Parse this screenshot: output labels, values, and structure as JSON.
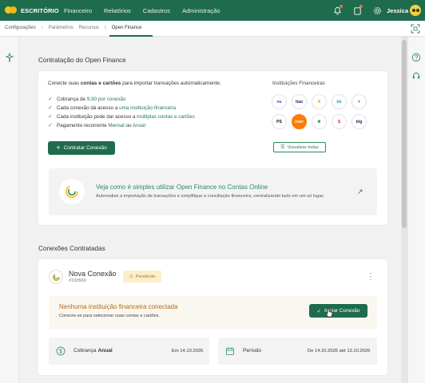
{
  "topbar": {
    "brand": "ESCRITÓRIO",
    "nav": [
      "Financeiro",
      "Relatórios",
      "Cadastros",
      "Administração"
    ],
    "icons": [
      "bell-settings-icon",
      "notification-icon",
      "gear-icon"
    ],
    "user": "Jessica"
  },
  "breadcrumb": {
    "items": [
      "Configurações",
      "Parâmetros",
      "Recursos",
      "Open Finance"
    ]
  },
  "contratacao": {
    "section_title": "Contratação do Open Finance",
    "intro_pre": "Conecte suas ",
    "intro_bold": "contas e cartões",
    "intro_post": " para importar transações automaticamente.",
    "features": [
      {
        "pre": "Cobrança de ",
        "hl": "9,90 por conexão",
        "post": ""
      },
      {
        "pre": "Cada conexão dá acesso a ",
        "hl": "uma instituição financeira",
        "post": ""
      },
      {
        "pre": "Cada instituição pode dar acesso a ",
        "hl": "múltiplas contas e cartões",
        "post": ""
      },
      {
        "pre": "Pagamento recorrente ",
        "hl": "Mensal",
        "mid": " ou ",
        "hl2": "Anual"
      }
    ],
    "contract_button": "Contratar Conexão",
    "institutions_title": "Instituições Financeiras",
    "institutions": [
      {
        "label": "nu",
        "color": "#7b2cbf"
      },
      {
        "label": "itaú",
        "color": "#1b2b6b"
      },
      {
        "label": "X",
        "color": "#f28c00"
      },
      {
        "label": "bb",
        "color": "#2aa3c3"
      },
      {
        "label": "▼",
        "color": "#56a832"
      },
      {
        "label": "PS",
        "color": "#111111"
      },
      {
        "label": "inter",
        "color": "#ff7a00"
      },
      {
        "label": "✱",
        "color": "#2c9e3c"
      },
      {
        "label": "S",
        "color": "#c8202f"
      },
      {
        "label": "btg",
        "color": "#0d2e5c"
      }
    ],
    "view_all_button": "Visualizar todas",
    "promo_title": "Veja como é simples utilizar Open Finance no Contas Online",
    "promo_subtitle": "Automatize a importação de transações e simplifique a conciliação financeira, centralizando tudo em um só lugar."
  },
  "conexoes": {
    "section_title": "Conexões Contratadas",
    "connection_name": "Nova Conexão",
    "connection_id": "#100569",
    "status": "Pendente",
    "no_institution_title": "Nenhuma instituição financeira conectada",
    "no_institution_sub": "Conecte-se para selecionar suas contas e cartões.",
    "start_button": "Iniciar Conexão",
    "billing_label_pre": "Cobrança ",
    "billing_label_bold": "Anual",
    "billing_value": "Em 14.10.2026",
    "period_label": "Período",
    "period_value": "De 14.10.2025 até 13.10.2026"
  },
  "colors": {
    "primary": "#1f6b4e",
    "accent": "#2a8a63",
    "warning": "#b56a1a",
    "badge": "#fbefc9"
  }
}
